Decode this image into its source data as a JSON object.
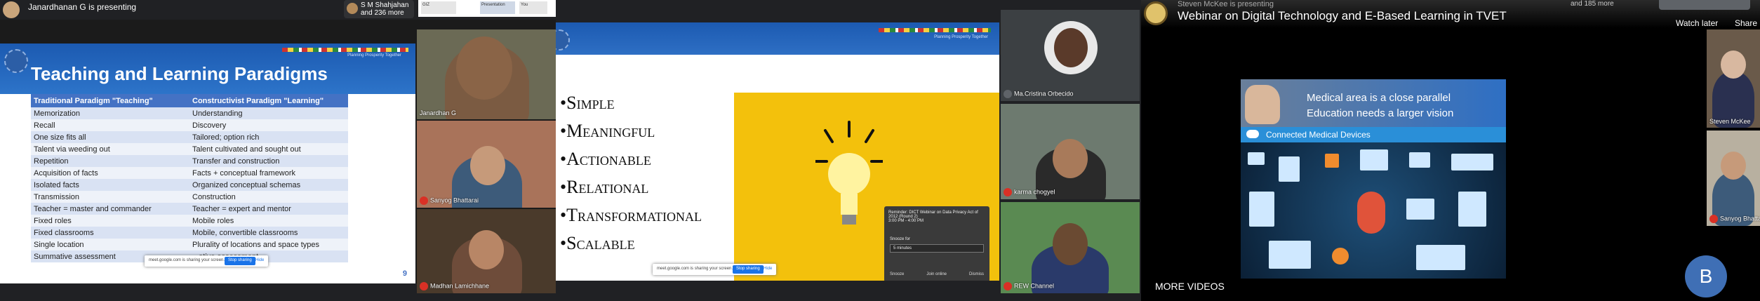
{
  "meet1": {
    "presenter_text": "Janardhanan G is presenting",
    "more_participants_line1": "S M Shahjahan",
    "more_participants_line2": "and 236 more",
    "thumb1": "GIZ",
    "thumb2": "Presentation",
    "thumb3": "You",
    "slide": {
      "title": "Teaching and Learning Paradigms",
      "tagline": "Planning Prosperity Together",
      "headers": [
        "Traditional Paradigm \"Teaching\"",
        "Constructivist Paradigm \"Learning\""
      ],
      "rows": [
        [
          "Memorization",
          "Understanding"
        ],
        [
          "Recall",
          "Discovery"
        ],
        [
          "One size fits all",
          "Tailored; option rich"
        ],
        [
          "Talent via weeding out",
          "Talent cultivated and sought out"
        ],
        [
          "Repetition",
          "Transfer and construction"
        ],
        [
          "Acquisition of facts",
          "Facts + conceptual framework"
        ],
        [
          "Isolated facts",
          "Organized conceptual schemas"
        ],
        [
          "Transmission",
          "Construction"
        ],
        [
          "Teacher = master and commander",
          "Teacher = expert and mentor"
        ],
        [
          "Fixed roles",
          "Mobile roles"
        ],
        [
          "Fixed classrooms",
          "Mobile, convertible classrooms"
        ],
        [
          "Single location",
          "Plurality of locations and space types"
        ],
        [
          "Summative assessment",
          "...ative assessment"
        ]
      ],
      "page_number": "9"
    },
    "share_bar": {
      "text": "meet.google.com is sharing your screen.",
      "stop": "Stop sharing",
      "hide": "Hide"
    },
    "participants": [
      "Janardhan G",
      "Sanyog Bhattarai",
      "Madhan Lamichhane"
    ]
  },
  "meet2": {
    "bullets": [
      "Simple",
      "Meaningful",
      "Actionable",
      "Relational",
      "Transformational",
      "Scalable"
    ],
    "tagline": "Planning Prosperity Together",
    "share_bar": {
      "text": "meet.google.com is sharing your screen.",
      "stop": "Stop sharing",
      "hide": "Hide"
    },
    "toast": {
      "title": "Reminder: DICT Webinar on Data Privacy Act of 2012 (Round 2)",
      "time": "3:00 PM - 4:00 PM",
      "snooze_label": "Snooze for",
      "snooze_value": "5 minutes",
      "actions": [
        "Snooze",
        "Join online",
        "Dismiss"
      ]
    },
    "participants": [
      "Ma.Cristina Orbecido",
      "karma chogyel",
      "REW Channel"
    ]
  },
  "youtube": {
    "subtitle": "Steven McKee is presenting",
    "title": "Webinar on Digital Technology and E-Based Learning in TVET",
    "more": "and 185 more",
    "watch_later": "Watch later",
    "share": "Share",
    "slide_line1": "Medical area is a close parallel",
    "slide_line2": "Education needs a larger vision",
    "slide_section": "Connected Medical Devices",
    "participants": [
      "Steven McKee",
      "Sanyog Bhattarai"
    ],
    "more_videos": "MORE VIDEOS",
    "avatar_letter": "B"
  },
  "colors": {
    "slide_blue": "#2d74c9",
    "table_header": "#4472c4",
    "bulb_yellow": "#f3c10c",
    "mic_off_red": "#d93025"
  }
}
